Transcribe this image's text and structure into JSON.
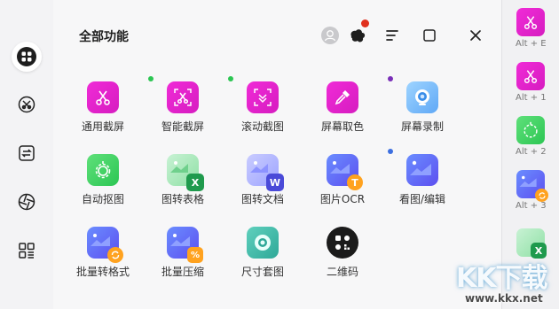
{
  "header": {
    "title": "全部功能"
  },
  "tools": [
    {
      "label": "通用截屏",
      "color": "magenta",
      "icon": "scissors-icon"
    },
    {
      "label": "智能截屏",
      "color": "magenta",
      "icon": "smart-scissors-icon"
    },
    {
      "label": "滚动截图",
      "color": "magenta",
      "icon": "scroll-capture-icon"
    },
    {
      "label": "屏幕取色",
      "color": "magenta",
      "icon": "eyedropper-icon"
    },
    {
      "label": "屏幕录制",
      "color": "sky",
      "icon": "camera-icon"
    },
    {
      "label": "自动抠图",
      "color": "green",
      "icon": "auto-cutout-icon"
    },
    {
      "label": "图转表格",
      "color": "green",
      "icon": "image-to-excel-icon",
      "badge": "X"
    },
    {
      "label": "图转文档",
      "color": "blue",
      "icon": "image-to-word-icon",
      "badge": "W"
    },
    {
      "label": "图片OCR",
      "color": "blue",
      "icon": "image-ocr-icon",
      "badge": "T"
    },
    {
      "label": "看图/编辑",
      "color": "blue",
      "icon": "image-view-icon"
    },
    {
      "label": "批量转格式",
      "color": "blue",
      "icon": "batch-convert-icon"
    },
    {
      "label": "批量压缩",
      "color": "blue",
      "icon": "batch-compress-icon"
    },
    {
      "label": "尺寸套图",
      "color": "teal",
      "icon": "size-template-icon"
    },
    {
      "label": "二维码",
      "color": "black",
      "icon": "qr-code-icon"
    }
  ],
  "dots": {
    "green": "#2cc653",
    "purple": "#7a2fb8",
    "blue": "#3d6fe0",
    "red": "#e0301e"
  },
  "shortcuts": [
    {
      "label": "Alt + E"
    },
    {
      "label": "Alt + 1"
    },
    {
      "label": "Alt + 2"
    },
    {
      "label": "Alt + 3"
    }
  ],
  "watermark": {
    "brand": "KK下载",
    "site": "www.kkx.net"
  }
}
